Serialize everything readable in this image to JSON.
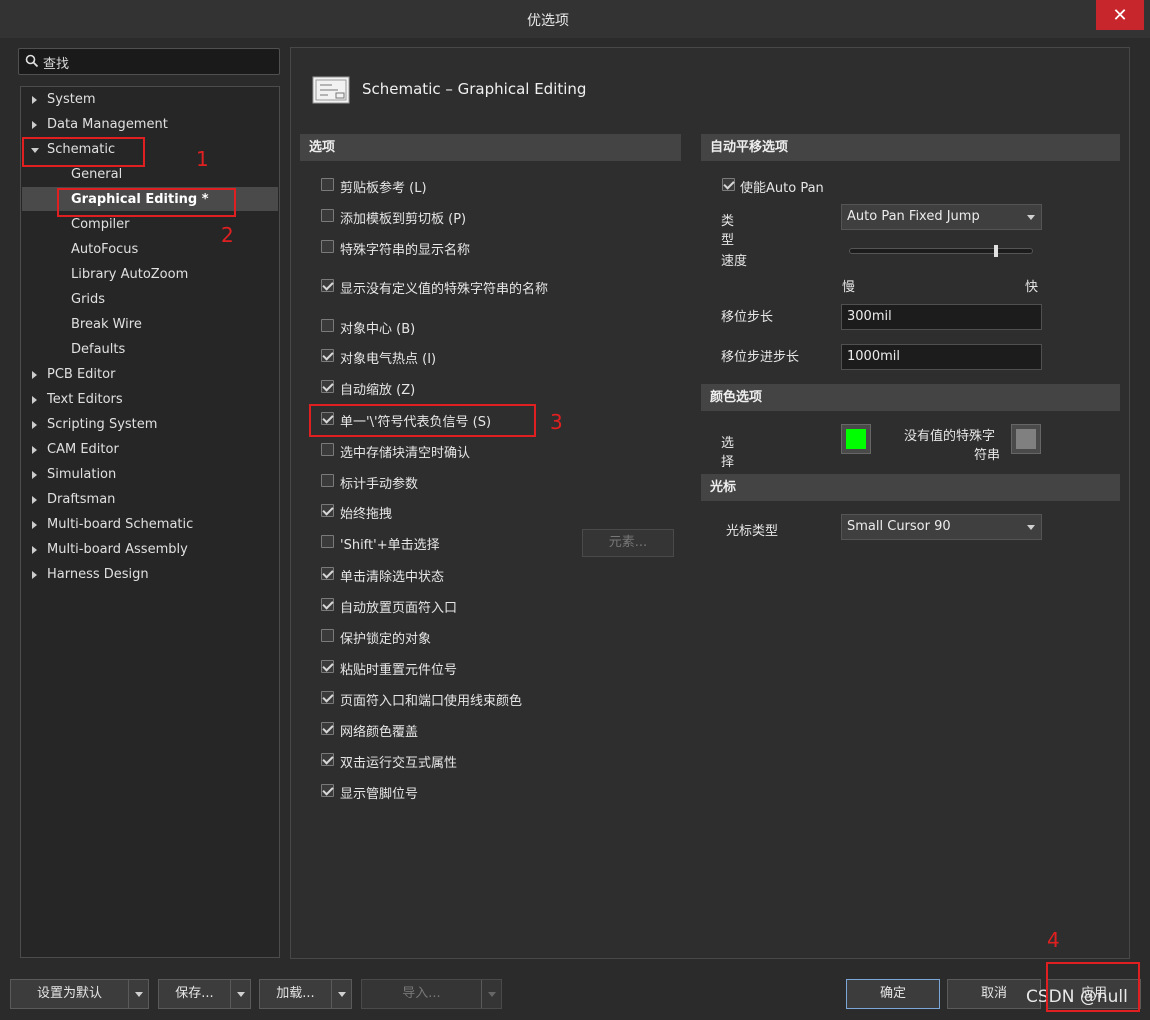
{
  "window": {
    "title": "优选项",
    "close": "✕"
  },
  "search": {
    "placeholder": "查找"
  },
  "tree": {
    "items": [
      {
        "label": "System"
      },
      {
        "label": "Data Management"
      },
      {
        "label": "Schematic"
      },
      {
        "label": "General"
      },
      {
        "label": "Graphical Editing *"
      },
      {
        "label": "Compiler"
      },
      {
        "label": "AutoFocus"
      },
      {
        "label": "Library AutoZoom"
      },
      {
        "label": "Grids"
      },
      {
        "label": "Break Wire"
      },
      {
        "label": "Defaults"
      },
      {
        "label": "PCB Editor"
      },
      {
        "label": "Text Editors"
      },
      {
        "label": "Scripting System"
      },
      {
        "label": "CAM Editor"
      },
      {
        "label": "Simulation"
      },
      {
        "label": "Draftsman"
      },
      {
        "label": "Multi-board Schematic"
      },
      {
        "label": "Multi-board Assembly"
      },
      {
        "label": "Harness Design"
      }
    ]
  },
  "page": {
    "title": "Schematic – Graphical Editing"
  },
  "options": {
    "header": "选项",
    "items": [
      {
        "label": "剪贴板参考 (L)",
        "checked": false
      },
      {
        "label": "添加模板到剪切板 (P)",
        "checked": false
      },
      {
        "label": "特殊字符串的显示名称",
        "checked": false
      },
      {
        "label": "显示没有定义值的特殊字符串的名称",
        "checked": true
      },
      {
        "label": "对象中心 (B)",
        "checked": false
      },
      {
        "label": "对象电气热点 (I)",
        "checked": true
      },
      {
        "label": "自动缩放 (Z)",
        "checked": true
      },
      {
        "label": "单一'\\'符号代表负信号 (S)",
        "checked": true
      },
      {
        "label": "选中存储块清空时确认",
        "checked": false
      },
      {
        "label": "标计手动参数",
        "checked": false
      },
      {
        "label": "始终拖拽",
        "checked": true
      },
      {
        "label": "'Shift'+单击选择",
        "checked": false
      },
      {
        "label": "单击清除选中状态",
        "checked": true
      },
      {
        "label": "自动放置页面符入口",
        "checked": true
      },
      {
        "label": "保护锁定的对象",
        "checked": false
      },
      {
        "label": "粘贴时重置元件位号",
        "checked": true
      },
      {
        "label": "页面符入口和端口使用线束颜色",
        "checked": true
      },
      {
        "label": "网络颜色覆盖",
        "checked": true
      },
      {
        "label": "双击运行交互式属性",
        "checked": true
      },
      {
        "label": "显示管脚位号",
        "checked": true
      }
    ],
    "elements_button": "元素..."
  },
  "autopan": {
    "header": "自动平移选项",
    "enable_label": "使能Auto Pan",
    "enable_checked": true,
    "type_label_1": "类",
    "type_label_2": "型",
    "type_value": "Auto Pan Fixed Jump",
    "speed_label": "速度",
    "speed_level": 0.8,
    "slow": "慢",
    "fast": "快",
    "step_label": "移位步长",
    "step_value": "300mil",
    "shift_step_label": "移位步进步长",
    "shift_step_value": "1000mil"
  },
  "color": {
    "header": "颜色选项",
    "select_label_1": "选",
    "select_label_2": "择",
    "select_color": "#00ff00",
    "novalue_label_1": "没有值的特殊字",
    "novalue_label_2": "符串",
    "novalue_color": "#808080"
  },
  "cursor": {
    "header": "光标",
    "type_label": "光标类型",
    "type_value": "Small Cursor 90"
  },
  "annotations": [
    "1",
    "2",
    "3",
    "4"
  ],
  "footer": {
    "set_default": "设置为默认",
    "save": "保存...",
    "load": "加载...",
    "import": "导入...",
    "ok": "确定",
    "cancel": "取消",
    "apply": "应用",
    "watermark": "CSDN @null"
  }
}
